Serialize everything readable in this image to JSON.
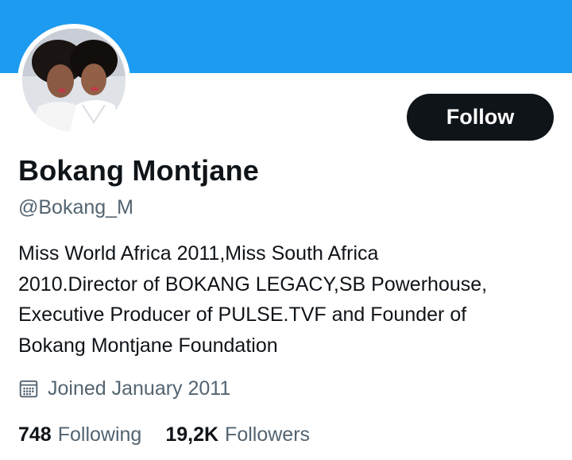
{
  "colors": {
    "banner": "#1d9bf0",
    "button_bg": "#0f1419",
    "button_text": "#ffffff",
    "primary_text": "#0f1419",
    "secondary_text": "#536471"
  },
  "profile": {
    "follow_label": "Follow",
    "display_name": "Bokang Montjane",
    "handle": "@Bokang_M",
    "bio_lines": [
      "Miss World Africa 2011,Miss South Africa",
      "2010.Director of BOKANG LEGACY,SB Powerhouse,",
      "Executive Producer of PULSE.TVF and Founder of",
      "Bokang Montjane Foundation"
    ],
    "joined_icon": "calendar-icon",
    "joined_text": "Joined January 2011",
    "following_count": "748",
    "following_label": "Following",
    "followers_count": "19,2K",
    "followers_label": "Followers"
  }
}
